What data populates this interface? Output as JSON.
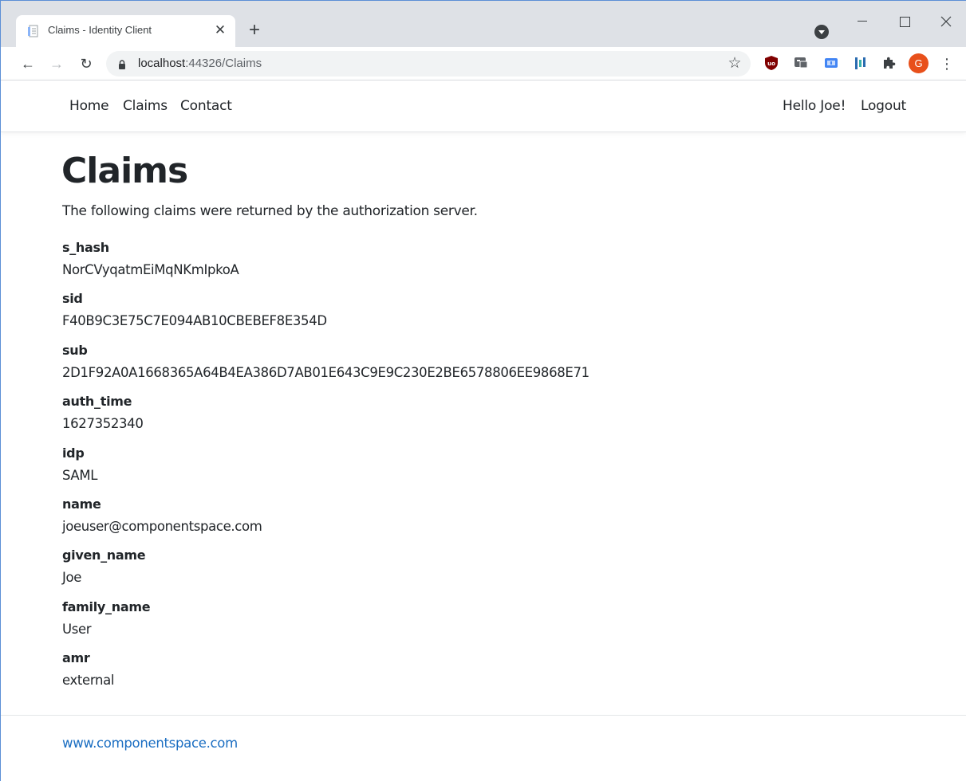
{
  "browser": {
    "tab": {
      "title": "Claims - Identity Client",
      "close_glyph": "✕",
      "favicon": "document-icon"
    },
    "new_tab_glyph": "+",
    "address": {
      "host": "localhost",
      "rest": ":44326/Claims"
    },
    "profile_initial": "G",
    "profile_color": "#e8501b",
    "icons": {
      "back": "←",
      "forward": "→",
      "reload": "↻",
      "star": "☆",
      "menu": "⋮"
    }
  },
  "site_nav": {
    "links": {
      "home": "Home",
      "claims": "Claims",
      "contact": "Contact"
    },
    "greeting": "Hello Joe!",
    "logout": "Logout"
  },
  "main": {
    "title": "Claims",
    "intro": "The following claims were returned by the authorization server.",
    "claims": [
      {
        "type": "s_hash",
        "value": "NorCVyqatmEiMqNKmIpkoA"
      },
      {
        "type": "sid",
        "value": "F40B9C3E75C7E094AB10CBEBEF8E354D"
      },
      {
        "type": "sub",
        "value": "2D1F92A0A1668365A64B4EA386D7AB01E643C9E9C230E2BE6578806EE9868E71"
      },
      {
        "type": "auth_time",
        "value": "1627352340"
      },
      {
        "type": "idp",
        "value": "SAML"
      },
      {
        "type": "name",
        "value": "joeuser@componentspace.com"
      },
      {
        "type": "given_name",
        "value": "Joe"
      },
      {
        "type": "family_name",
        "value": "User"
      },
      {
        "type": "amr",
        "value": "external"
      }
    ]
  },
  "footer": {
    "link": "www.componentspace.com"
  },
  "colors": {
    "link": "#1b6ec2",
    "tabstrip": "#dee1e6"
  }
}
